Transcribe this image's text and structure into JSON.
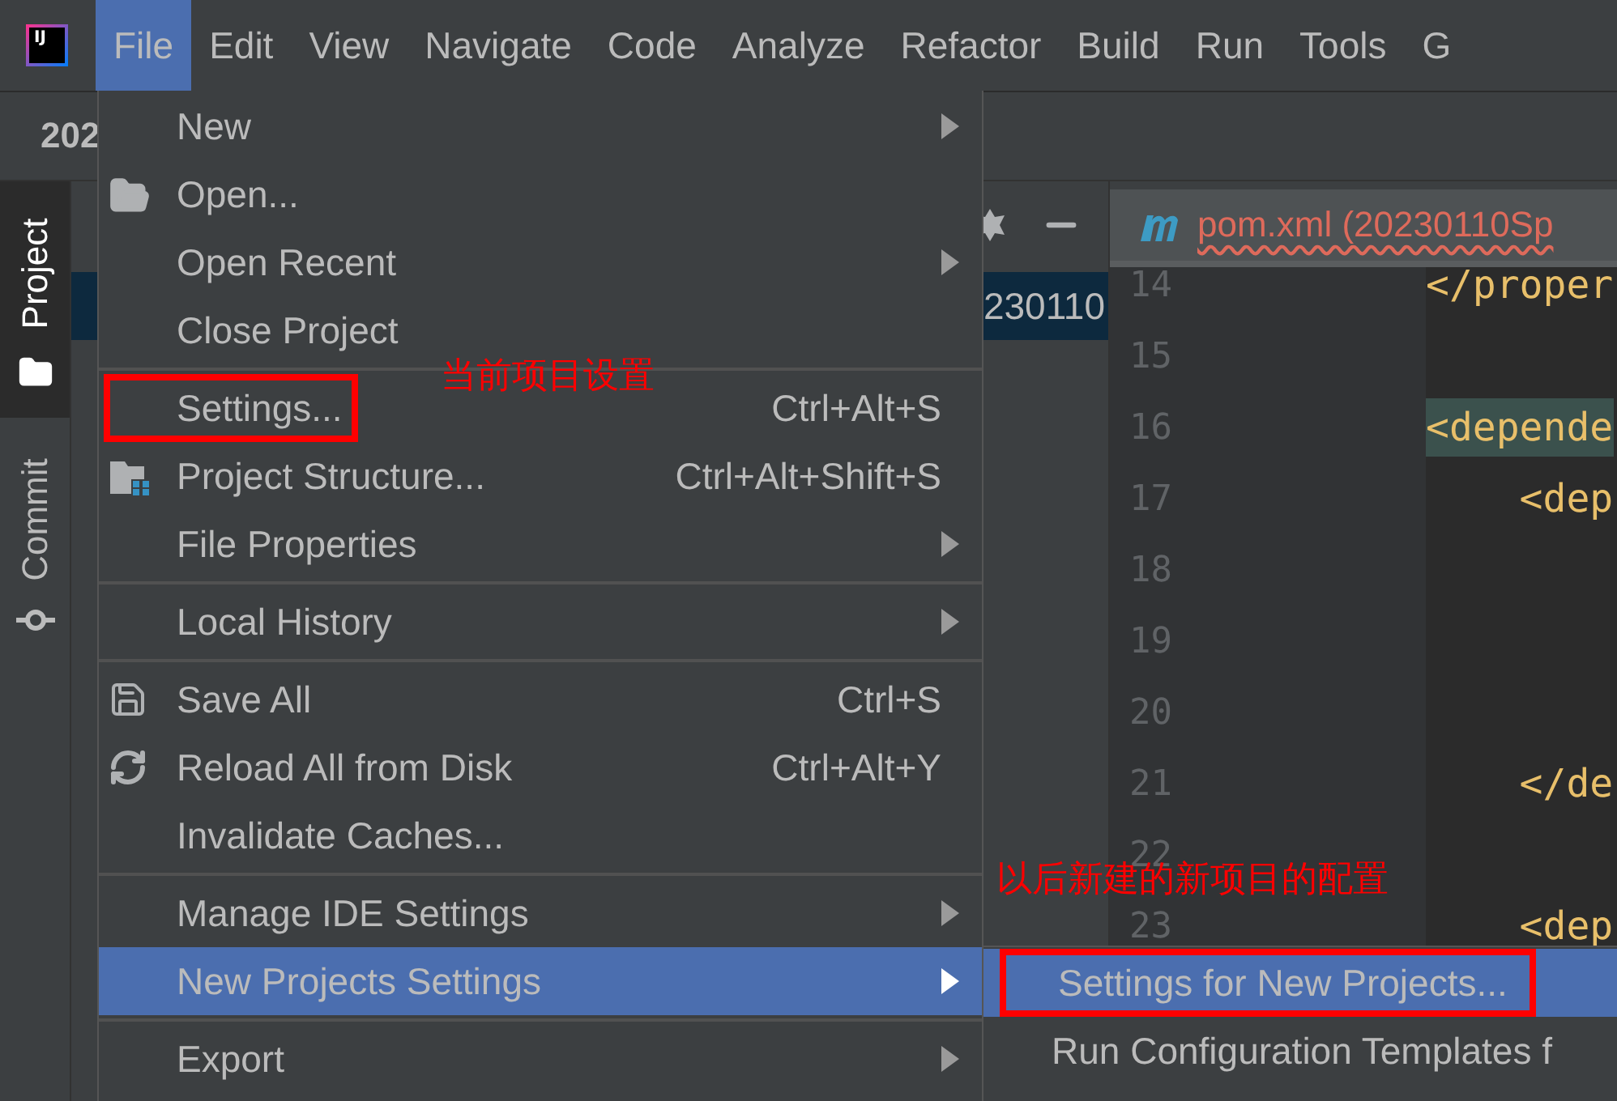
{
  "logo": "IJ",
  "menu_bar": [
    {
      "label": "File",
      "selected": true
    },
    {
      "label": "Edit",
      "selected": false
    },
    {
      "label": "View",
      "selected": false
    },
    {
      "label": "Navigate",
      "selected": false
    },
    {
      "label": "Code",
      "selected": false
    },
    {
      "label": "Analyze",
      "selected": false
    },
    {
      "label": "Refactor",
      "selected": false
    },
    {
      "label": "Build",
      "selected": false
    },
    {
      "label": "Run",
      "selected": false
    },
    {
      "label": "Tools",
      "selected": false
    },
    {
      "label": "G",
      "selected": false
    }
  ],
  "navigation_bar": {
    "project": "202"
  },
  "tool_windows": [
    {
      "label": "Project",
      "selected": true
    },
    {
      "label": "Commit",
      "selected": false
    }
  ],
  "project_panel": {
    "selected_row": "230110"
  },
  "editor": {
    "tab": "pom.xml (20230110Sp",
    "lines": [
      {
        "number": "14",
        "code": "</proper",
        "highlighted": false
      },
      {
        "number": "15"
      },
      {
        "number": "16",
        "code": "<depende",
        "highlighted": true
      },
      {
        "number": "17",
        "code": "    <dep",
        "highlighted": false
      },
      {
        "number": "18"
      },
      {
        "number": "19"
      },
      {
        "number": "20"
      },
      {
        "number": "21",
        "code": "    </de",
        "highlighted": false
      },
      {
        "number": "22"
      },
      {
        "number": "23",
        "code": "    <dep",
        "highlighted": false
      }
    ]
  },
  "file_menu": [
    [
      {
        "label": "New",
        "submenu": true,
        "selected": false,
        "boxed": false
      },
      {
        "label": "Open...",
        "submenu": false,
        "selected": false,
        "boxed": false
      },
      {
        "label": "Open Recent",
        "submenu": true,
        "selected": false,
        "boxed": false
      },
      {
        "label": "Close Project",
        "submenu": false,
        "selected": false,
        "boxed": false
      }
    ],
    [
      {
        "label": "Settings...",
        "shortcut": "Ctrl+Alt+S",
        "submenu": false,
        "selected": false,
        "boxed": true
      },
      {
        "label": "Project Structure...",
        "shortcut": "Ctrl+Alt+Shift+S",
        "submenu": false,
        "selected": false,
        "boxed": false
      },
      {
        "label": "File Properties",
        "submenu": true,
        "selected": false,
        "boxed": false
      }
    ],
    [
      {
        "label": "Local History",
        "submenu": true,
        "selected": false,
        "boxed": false
      }
    ],
    [
      {
        "label": "Save All",
        "shortcut": "Ctrl+S",
        "submenu": false,
        "selected": false,
        "boxed": false
      },
      {
        "label": "Reload All from Disk",
        "shortcut": "Ctrl+Alt+Y",
        "submenu": false,
        "selected": false,
        "boxed": false
      },
      {
        "label": "Invalidate Caches...",
        "submenu": false,
        "selected": false,
        "boxed": false
      }
    ],
    [
      {
        "label": "Manage IDE Settings",
        "submenu": true,
        "selected": false,
        "boxed": false
      },
      {
        "label": "New Projects Settings",
        "submenu": true,
        "selected": true,
        "boxed": false
      }
    ],
    [
      {
        "label": "Export",
        "submenu": true,
        "selected": false,
        "boxed": false
      }
    ]
  ],
  "submenu": [
    {
      "label": "Settings for New Projects...",
      "selected": true,
      "boxed": true
    },
    {
      "label": "Run Configuration Templates f",
      "selected": false,
      "boxed": false
    }
  ],
  "annotations": [
    "当前项目设置",
    "以后新建的新项目的配置"
  ]
}
